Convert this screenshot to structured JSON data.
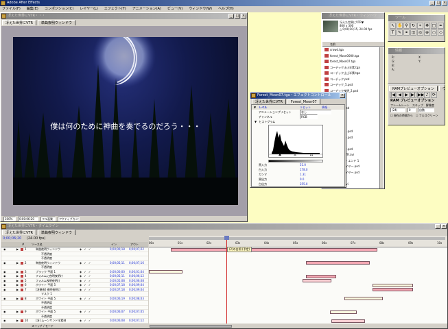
{
  "app": {
    "title": "Adobe After Effects"
  },
  "menu": [
    "ファイル(F)",
    "編集(E)",
    "コンポジション(C)",
    "レイヤー(L)",
    "エフェクト(T)",
    "アニメーション(A)",
    "ビュー(V)",
    "ウィンドウ(W)",
    "ヘルプ(H)"
  ],
  "comp": {
    "title": "冴えた世界にVTR・・・",
    "tabs": [
      "冴えた世界にVTR",
      "単曲夜明ウィンドウ"
    ],
    "subtitle": "僕は何のために神曲を奏でるのだろう・・・",
    "zoom": "100%",
    "timecode": "0:00:06:20",
    "quality": "フル画質",
    "view": "アクティブカメラ"
  },
  "project": {
    "title": "冴えた世界にVTR・ウィンドウ",
    "info": [
      "冴えた世界にVTR▼",
      "800 x 300",
      "△ 0;00;10;15, 24.00 fps"
    ],
    "col_header": "名前",
    "items": [
      "crowd.tga",
      "forest_Moon0000.tga",
      "forest_Moon07.tga",
      "コーデック止止半素.tga",
      "コーデック止止半素.tga",
      "コーデック.psd",
      "コーデック_5.psd",
      "コーデック夜明_2.psd",
      "ブチ素.tga",
      "ムーン素.tga",
      "テクスチャ.psd",
      "カメラ",
      "レイヤー",
      "夜明け素",
      "夜明け素材_1.psd",
      "夜明け素材_5.psd",
      "ウィンドウ",
      "夜明け素材_2.psd",
      "冴えた世界VTR.avi",
      "調整 レイヤー エンド 1",
      "調整.認め レイヤー.psd",
      "調整.認め レイヤー.psd",
      "フォルダ",
      "シーンVTR.avi"
    ]
  },
  "levels": {
    "title": "Forest_Moon07.tga・エフェクトコントロール",
    "tabs": [
      "冴えた世界にVTR",
      "Forest_Moon07"
    ],
    "effect_name": "レベル",
    "reset": "リセット",
    "about": "情報...",
    "rows": [
      {
        "label": "アニメーションプリセット",
        "value": "なし"
      },
      {
        "label": "チャンネル",
        "value": "RGB"
      },
      {
        "label": "ヒストグラム",
        "value": ""
      },
      {
        "label": "黒入力",
        "value": "51.0"
      },
      {
        "label": "白入力",
        "value": "178.0"
      },
      {
        "label": "ガンマ",
        "value": "1.31"
      },
      {
        "label": "黒出力",
        "value": "0.0"
      },
      {
        "label": "白出力",
        "value": "255.0"
      }
    ]
  },
  "tools": {
    "title": "ツール"
  },
  "info": {
    "title": "情報",
    "lines": [
      "R:",
      "G:",
      "B:",
      "A:",
      "X:",
      "Y:"
    ]
  },
  "preview": {
    "tabs": [
      "RAMプレビューオプション",
      "ウェブブラウザ"
    ],
    "heading": "RAM プレビューオプション",
    "labels": [
      "フレームレート",
      "スキップ",
      "解像度"
    ],
    "values": [
      "(24)",
      "0",
      "自動"
    ],
    "opt1": "現在の時間から",
    "opt2": "フルスクリーン"
  },
  "timeline": {
    "title": "冴えた世界にVTR・タイムライン",
    "tabs": [
      "冴えた世界にVTR",
      "単曲夜明ウィンドウ"
    ],
    "timecode": "0;00;06;20",
    "fps": "(24.00 fps)",
    "headers": {
      "num": "#",
      "name": "ソース名",
      "switches": "",
      "in": "イン",
      "out": "アウト"
    },
    "layers": [
      {
        "num": "1",
        "name": "単曲夜明ウィンドウ",
        "in": "0;00;00;18",
        "out": "0;00;07;22"
      },
      {
        "num": "",
        "name": "不透明度",
        "in": "",
        "out": ""
      },
      {
        "num": "",
        "name": "不透明度",
        "in": "",
        "out": ""
      },
      {
        "num": "2",
        "name": "単曲夜明ウィンドウ",
        "in": "0;00;05;11",
        "out": "0;00;07;16"
      },
      {
        "num": "",
        "name": "不透明度",
        "in": "",
        "out": ""
      },
      {
        "num": "3",
        "name": "ブラック 平面 1",
        "in": "0;00;00;00",
        "out": "0;00;01;04"
      },
      {
        "num": "4",
        "name": "フォルムに夜明夜明け",
        "in": "0;00;05;11",
        "out": "0;00;06;12"
      },
      {
        "num": "5",
        "name": "フォルム夜明夜明け",
        "in": "0;00;05;08",
        "out": "0;00;06;08"
      },
      {
        "num": "6",
        "name": "ホワイト 平面 5",
        "in": "0;00;07;18",
        "out": "0;00;09;04"
      },
      {
        "num": "7",
        "name": "[冴連夜] 夜明夜明け",
        "in": "0;00;07;18",
        "out": "0;00;09;04"
      },
      {
        "num": "",
        "name": "マスク 1",
        "in": "",
        "out": ""
      },
      {
        "num": "8",
        "name": "ホワイト 平面 5",
        "in": "0;00;06;19",
        "out": "0;00;08;03"
      },
      {
        "num": "",
        "name": "不透明度",
        "in": "",
        "out": ""
      },
      {
        "num": "",
        "name": "不透明度",
        "in": "",
        "out": ""
      },
      {
        "num": "9",
        "name": "ホワイト 平面 5",
        "in": "0;00;06;07",
        "out": "0;00;07;05"
      },
      {
        "num": "",
        "name": "不透明度",
        "in": "",
        "out": ""
      },
      {
        "num": "10",
        "name": "[冴] ムーンサンド半素材",
        "in": "0;00;06;08",
        "out": "0;00;07;12"
      }
    ],
    "ruler": [
      "00s",
      "01s",
      "02s",
      "03s",
      "04s",
      "05s",
      "06s",
      "07s",
      "08s",
      "09s",
      "10s"
    ],
    "marker": "(2)の台詞 (予定)",
    "footer": "スイッチ / モード"
  },
  "colors": {
    "title_active": "#0a246a",
    "desktop": "#fdfdc2",
    "bar_pink": "#f4a7b3",
    "bar_pale": "#f9d0d4",
    "bar_yellow": "#fafae0",
    "playhead": "#d02020"
  }
}
